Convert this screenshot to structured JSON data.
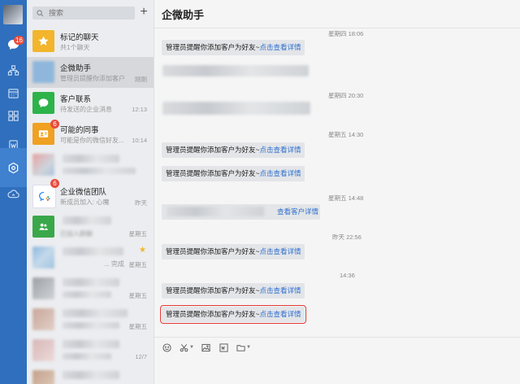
{
  "rail": {
    "message_badge": "16",
    "icons": [
      "avatar",
      "chat-icon",
      "contacts-icon",
      "calendar-icon",
      "apps-icon",
      "doc-icon",
      "workbench-icon",
      "cloud-icon"
    ]
  },
  "search": {
    "placeholder": "搜索"
  },
  "conversations": [
    {
      "name": "标记的聊天",
      "sub": "共1个聊天",
      "time": "",
      "color": "#f2b52c",
      "icon": "star-icon",
      "badge": ""
    },
    {
      "name": "企微助手",
      "sub": "管理员提醒你添加客户...",
      "time": "刚刚",
      "color": "#8fb7dc",
      "icon": "assistant-icon",
      "badge": ""
    },
    {
      "name": "客户联系",
      "sub": "待发送的企业消息",
      "time": "12:13",
      "color": "#2db34a",
      "icon": "chat-bubble-icon",
      "badge": ""
    },
    {
      "name": "可能的同事",
      "sub": "可能是你的微信好友...",
      "time": "10:14",
      "color": "#f0a022",
      "icon": "id-card-icon",
      "badge": "6"
    },
    {
      "name": "",
      "sub": "",
      "time": "",
      "color": "#d9a9a9",
      "icon": "blurred-avatar",
      "badge": ""
    },
    {
      "name": "企业微信团队",
      "sub": "新成员加入: 心魔",
      "time": "昨天",
      "color": "#ffffff",
      "icon": "wecom-logo-icon",
      "badge": "6"
    },
    {
      "name": "",
      "sub": "已加入群聊",
      "time": "星期五",
      "color": "#3aa84a",
      "icon": "group-icon",
      "badge": ""
    },
    {
      "name": "",
      "sub": "... 完成",
      "time": "星期五",
      "color": "#9fc4e0",
      "icon": "blurred-avatar",
      "badge": "",
      "star": "★"
    },
    {
      "name": "",
      "sub": "",
      "time": "星期五",
      "color": "#b9bcc0",
      "icon": "blurred-avatar",
      "badge": ""
    },
    {
      "name": "",
      "sub": "",
      "time": "星期五",
      "color": "#c9a79a",
      "icon": "blurred-avatar",
      "badge": ""
    },
    {
      "name": "",
      "sub": "",
      "time": "12/7",
      "color": "#d8b7b7",
      "icon": "blurred-avatar",
      "badge": ""
    },
    {
      "name": "",
      "sub": "",
      "time": "",
      "color": "#c4a089",
      "icon": "blurred-avatar",
      "badge": ""
    }
  ],
  "chat": {
    "title": "企微助手",
    "reminder_text": "管理员提醒你添加客户为好友~",
    "link_text": "点击查看详情",
    "link2_text": "查看客户详情",
    "timestamps": [
      "星期四 18:06",
      "星期四 20:30",
      "星期五 14:30",
      "星期五 14:48",
      "昨天 22:56",
      "14:36"
    ]
  },
  "toolbar": {
    "tools": [
      "emoji-icon",
      "scissors-icon",
      "image-icon",
      "word-doc-icon",
      "folder-icon"
    ]
  }
}
